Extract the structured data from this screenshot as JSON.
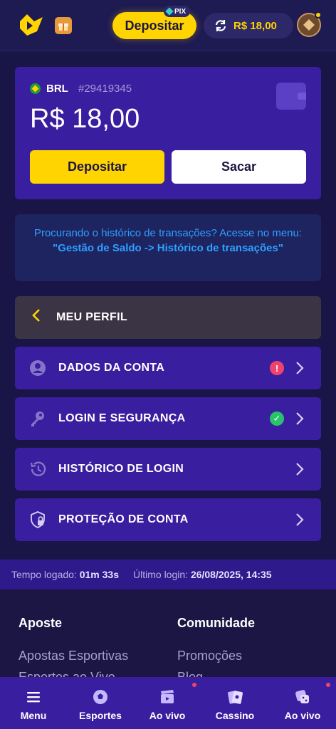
{
  "header": {
    "deposit_label": "Depositar",
    "pix_label": "PIX",
    "balance": "R$ 18,00"
  },
  "card": {
    "currency": "BRL",
    "account_id": "#29419345",
    "balance": "R$ 18,00",
    "deposit_label": "Depositar",
    "withdraw_label": "Sacar"
  },
  "info": {
    "text": "Procurando o histórico de transações? Acesse no menu: ",
    "highlight": "\"Gestão de Saldo -> Histórico de transações\""
  },
  "profile": {
    "back_label": "MEU PERFIL",
    "items": [
      {
        "label": "DADOS DA CONTA",
        "icon": "user-icon",
        "status": "warning",
        "status_glyph": "!"
      },
      {
        "label": "LOGIN E SEGURANÇA",
        "icon": "key-icon",
        "status": "ok",
        "status_glyph": "✓"
      },
      {
        "label": "HISTÓRICO DE LOGIN",
        "icon": "history-icon",
        "status": "",
        "status_glyph": ""
      },
      {
        "label": "PROTEÇÃO DE CONTA",
        "icon": "shield-lock-icon",
        "status": "",
        "status_glyph": ""
      }
    ]
  },
  "session": {
    "time_label": "Tempo logado:",
    "time_value": "01m 33s",
    "last_label": "Último login:",
    "last_value": "26/08/2025, 14:35"
  },
  "footer": {
    "col1_title": "Aposte",
    "col1_links": [
      "Apostas Esportivas",
      "Esportes ao Vivo"
    ],
    "col2_title": "Comunidade",
    "col2_links": [
      "Promoções",
      "Blog"
    ]
  },
  "bottom_nav": [
    {
      "label": "Menu",
      "icon": "menu-icon"
    },
    {
      "label": "Esportes",
      "icon": "ball-icon"
    },
    {
      "label": "Ao vivo",
      "icon": "clapper-icon"
    },
    {
      "label": "Cassino",
      "icon": "cards-icon"
    },
    {
      "label": "Ao vivo",
      "icon": "dice-icon"
    }
  ],
  "colors": {
    "accent": "#ffd400",
    "card": "#3a1ea0",
    "background": "#1a1547",
    "info_text": "#2f9fff",
    "warning": "#f0436b",
    "success": "#2ac26a"
  }
}
